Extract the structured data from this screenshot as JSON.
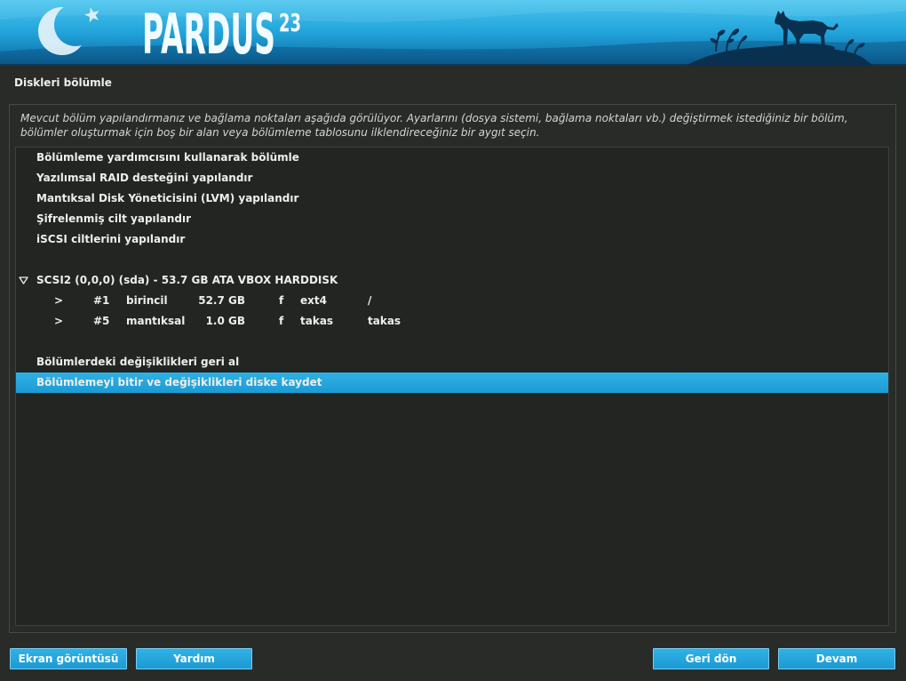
{
  "header": {
    "logo_text": "PARDUS",
    "logo_version": "23",
    "artwork": [
      "crescent-icon",
      "star-icon",
      "panther-silhouette"
    ]
  },
  "page": {
    "title": "Diskleri bölümle",
    "description_lines": [
      "Mevcut bölüm yapılandırmanız ve bağlama noktaları aşağıda görülüyor. Ayarlarını (dosya sistemi, bağlama noktaları vb.) değiştirmek istediğiniz bir bölüm,",
      "bölümler oluşturmak için boş bir alan veya bölümleme tablosunu ilklendireceğiniz bir aygıt seçin."
    ]
  },
  "list": {
    "items": [
      {
        "type": "action",
        "label": "Bölümleme yardımcısını kullanarak bölümle"
      },
      {
        "type": "action",
        "label": "Yazılımsal RAID desteğini yapılandır"
      },
      {
        "type": "action",
        "label": "Mantıksal Disk Yöneticisini (LVM) yapılandır"
      },
      {
        "type": "action",
        "label": "Şifrelenmiş cilt yapılandır"
      },
      {
        "type": "action",
        "label": "iSCSI ciltlerini yapılandır"
      },
      {
        "type": "spacer"
      },
      {
        "type": "disk",
        "label": "SCSI2 (0,0,0) (sda) - 53.7 GB ATA VBOX HARDDISK",
        "expanded": true,
        "icon": "expander-down-icon"
      },
      {
        "type": "partition",
        "arrow": ">",
        "number": "#1",
        "kind": "birincil",
        "size": "52.7 GB",
        "flag": "f",
        "filesystem": "ext4",
        "mount": "/"
      },
      {
        "type": "partition",
        "arrow": ">",
        "number": "#5",
        "kind": "mantıksal",
        "size": "1.0 GB",
        "flag": "f",
        "filesystem": "takas",
        "mount": "takas"
      },
      {
        "type": "spacer"
      },
      {
        "type": "action",
        "label": "Bölümlerdeki değişiklikleri geri al"
      },
      {
        "type": "action",
        "label": "Bölümlemeyi bitir ve değişiklikleri diske kaydet",
        "selected": true
      }
    ]
  },
  "buttons": {
    "screenshot": "Ekran görüntüsü",
    "help": "Yardım",
    "back": "Geri dön",
    "continue": "Devam"
  },
  "colors": {
    "accent": "#1c9ad3",
    "accent_light": "#2fb2e6",
    "background": "#282b28",
    "text": "#eeeeec",
    "muted_text": "#d3d7cf"
  }
}
